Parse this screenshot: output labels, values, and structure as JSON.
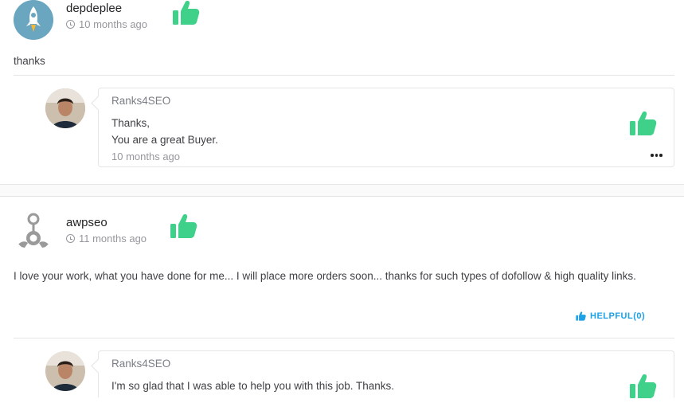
{
  "colors": {
    "thumb_green": "#3fd18a",
    "helpful_blue": "#1da1e6"
  },
  "reviews": [
    {
      "username": "depdeplee",
      "time": "10 months ago",
      "text": "thanks",
      "avatar_icon": "rocket-icon",
      "reply": {
        "seller": "Ranks4SEO",
        "lines": [
          "Thanks,",
          "You are a great Buyer."
        ],
        "time": "10 months ago"
      }
    },
    {
      "username": "awpseo",
      "time": "11 months ago",
      "text": "I love your work, what you have done for me... I will place more orders soon... thanks for such types of dofollow & high quality links.",
      "avatar_icon": "person-placeholder-icon",
      "helpful_label": "HELPFUL(0)",
      "reply": {
        "seller": "Ranks4SEO",
        "lines": [
          "I'm so glad that I was able to help you with this job. Thanks."
        ]
      }
    }
  ]
}
